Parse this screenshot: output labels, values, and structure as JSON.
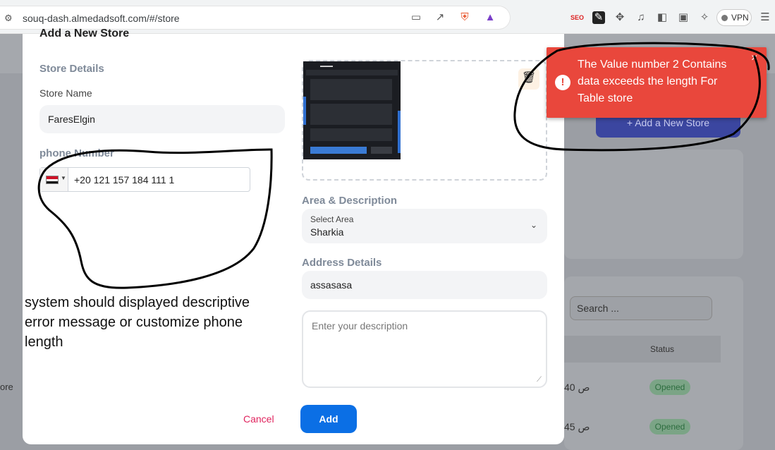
{
  "browser": {
    "url": "souq-dash.almedadsoft.com/#/store",
    "vpn_label": "VPN",
    "extension_badge_text": "SEO"
  },
  "background": {
    "add_store_button": "+ Add a New Store",
    "search_placeholder": "Search ...",
    "status_header": "Status",
    "rows": [
      {
        "value": "ص 40",
        "status": "Opened"
      },
      {
        "value": "ص 45",
        "status": "Opened"
      }
    ],
    "left_text": "ore"
  },
  "modal": {
    "title": "Add a New Store",
    "store_details_title": "Store Details",
    "store_name_label": "Store Name",
    "store_name_value": "FaresElgin",
    "phone_label": "phone Number",
    "phone_value": "+20 121 157 184 111 1",
    "phone_country": "egypt-flag",
    "area_section_title": "Area & Description",
    "select_area_label": "Select Area",
    "select_area_value": "Sharkia",
    "address_title": "Address Details",
    "address_value": "assasasa",
    "description_placeholder": "Enter your description",
    "cancel_label": "Cancel",
    "add_label": "Add"
  },
  "toast": {
    "message": "The Value number 2 Contains data exceeds the length For Table store",
    "close": "×",
    "icon": "!",
    "color": "#e9473c"
  },
  "annotation": {
    "text": "system should displayed descriptive error message or customize phone length"
  }
}
